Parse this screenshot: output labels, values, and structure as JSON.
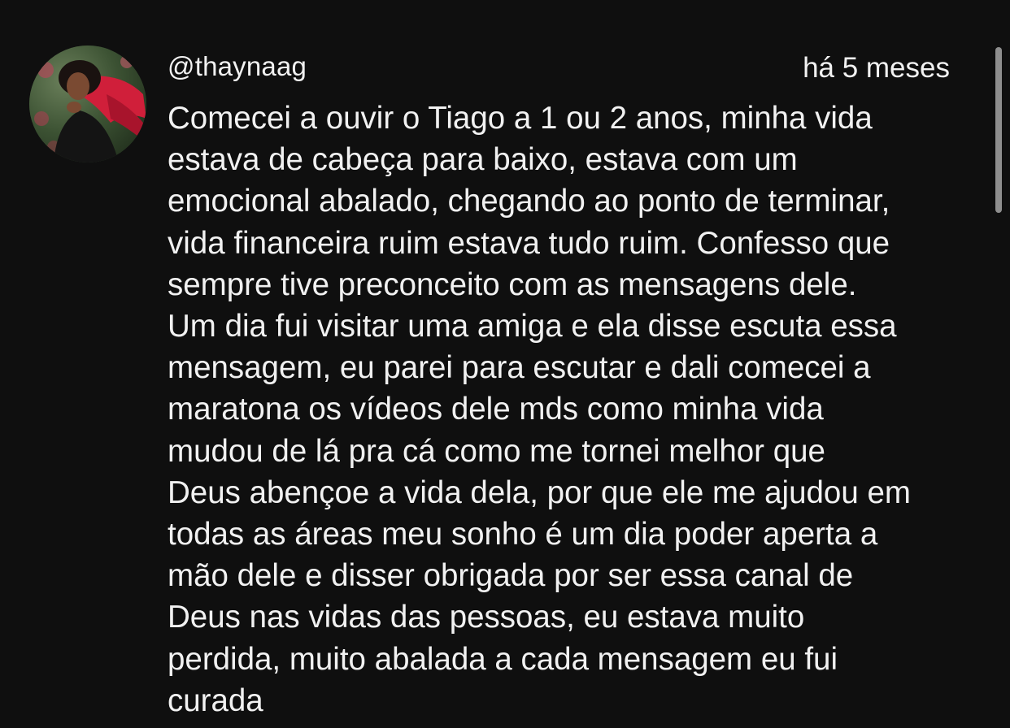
{
  "comment": {
    "author": "@thaynaag",
    "timestamp": "há 5 meses",
    "avatar_icon": "user-avatar-photo",
    "lines": [
      "Comecei a ouvir o Tiago a 1 ou 2 anos, minha vida",
      "estava de cabeça para baixo, estava com um",
      "emocional abalado, chegando ao ponto de terminar,",
      "vida financeira ruim estava tudo ruim. Confesso que",
      "sempre tive preconceito com as mensagens dele.",
      "Um dia fui visitar uma amiga e ela disse escuta essa",
      "mensagem, eu parei para escutar e dali comecei a",
      "maratona os vídeos dele mds como minha vida",
      "mudou de lá pra cá como me tornei melhor que",
      "Deus abençoe a vida dela, por que ele me ajudou em",
      "todas as áreas meu sonho é um dia poder aperta a",
      "mão dele e disser obrigada por ser essa canal de",
      "Deus nas vidas das pessoas, eu estava muito",
      "perdida, muito abalada a cada mensagem eu fui",
      "curada"
    ]
  },
  "colors": {
    "background": "#0f0f0f",
    "text": "#f1f1f1",
    "scrollbar": "#8e8e8e"
  }
}
